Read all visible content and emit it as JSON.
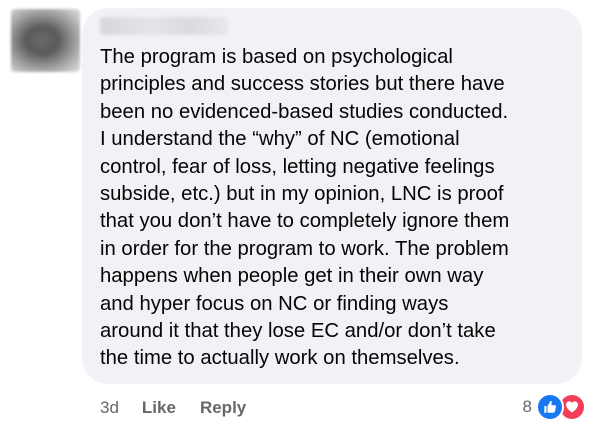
{
  "comment": {
    "lines": [
      "The program is based on psychological",
      "principles and success stories but there have",
      "been no evidenced-based studies conducted.",
      "I understand the “why” of NC (emotional",
      "control, fear of loss, letting negative feelings",
      "subside, etc.) but in my opinion, LNC is proof",
      "that you don’t have to completely ignore them",
      "in order for the program to work. The problem",
      "happens when people get in their own way",
      "and hyper focus on NC or finding ways",
      "around it that they lose EC and/or don’t take",
      "the time to actually work on themselves."
    ]
  },
  "actions": {
    "timestamp": "3d",
    "like_label": "Like",
    "reply_label": "Reply"
  },
  "reactions": {
    "count": "8",
    "icons": [
      "like-icon",
      "love-icon"
    ],
    "colors": {
      "like": "#1877f2",
      "love": "#f33e58"
    }
  },
  "colors": {
    "bubble_background": "#f0f2f5",
    "text": "#050505",
    "secondary_text": "#65676b"
  }
}
